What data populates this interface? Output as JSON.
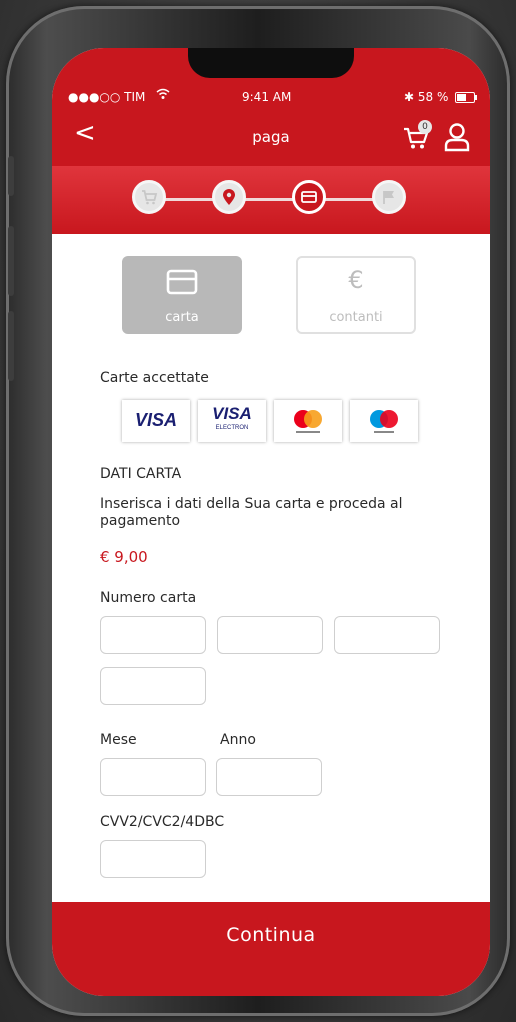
{
  "status_bar": {
    "carrier": "●●●○○ TIM",
    "time": "9:41 AM",
    "battery": "✱ 58 %",
    "battery_level": 0.58
  },
  "nav": {
    "back_icon": "chevron-left",
    "back_glyph": "<",
    "title": "paga",
    "cart_count": "0"
  },
  "steps": [
    {
      "icon": "cart-icon",
      "active": false
    },
    {
      "icon": "location-pin-icon",
      "active": false
    },
    {
      "icon": "credit-card-icon",
      "active": true
    },
    {
      "icon": "flag-icon",
      "active": false
    }
  ],
  "payment_methods": {
    "card": {
      "label": "carta",
      "selected": true
    },
    "cash": {
      "label": "contanti",
      "icon_glyph": "€",
      "selected": false
    }
  },
  "accepted": {
    "heading": "Carte accettate",
    "cards": [
      {
        "name": "visa",
        "text": "VISA"
      },
      {
        "name": "visa-electron",
        "text": "VISA",
        "sub": "ELECTRON"
      },
      {
        "name": "mastercard"
      },
      {
        "name": "maestro"
      }
    ]
  },
  "card_data": {
    "heading": "DATI CARTA",
    "instruction": "Inserisca i dati della Sua carta e proceda al pagamento",
    "amount": "€ 9,00",
    "card_number_label": "Numero carta",
    "month_label": "Mese",
    "year_label": "Anno",
    "cvv_label": "CVV2/CVC2/4DBC"
  },
  "footer": {
    "continue_label": "Continua"
  },
  "colors": {
    "brand_red": "#c8171e",
    "selected_tab": "#b8b8b8",
    "amount_red": "#c8171e"
  }
}
